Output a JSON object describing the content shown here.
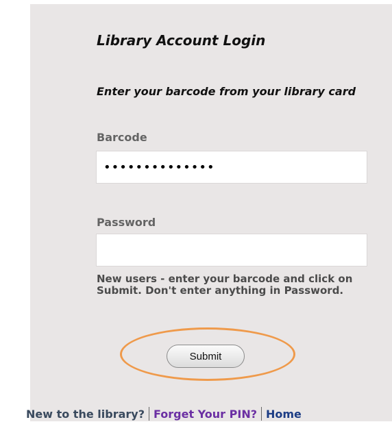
{
  "login": {
    "title": "Library Account Login",
    "instruction": "Enter your barcode from your library card",
    "barcode_label": "Barcode",
    "barcode_value": "••••••••••••••",
    "password_label": "Password",
    "password_value": "",
    "hint": "New users - enter your barcode and click on Submit. Don't enter anything in Password.",
    "submit_label": "Submit"
  },
  "footer": {
    "new_text": "New to the library?",
    "forgot_link": "Forget Your PIN?",
    "home_link": "Home"
  },
  "colors": {
    "panel_bg": "#e9e6e6",
    "highlight": "#ef9a4b",
    "forgot_link": "#6b2fa3",
    "home_link": "#1d3d85"
  }
}
